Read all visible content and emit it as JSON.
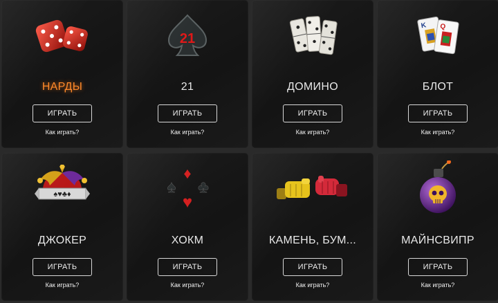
{
  "cards": [
    {
      "title": "НАРДЫ",
      "button": "ИГРАТЬ",
      "howto": "Как играть?",
      "icon": "dice-icon",
      "active": true
    },
    {
      "title": "21",
      "button": "ИГРАТЬ",
      "howto": "Как играть?",
      "icon": "blackjack-spade-icon"
    },
    {
      "title": "ДОМИНО",
      "button": "ИГРАТЬ",
      "howto": "Как играть?",
      "icon": "domino-icon"
    },
    {
      "title": "БЛОТ",
      "button": "ИГРАТЬ",
      "howto": "Как играть?",
      "icon": "playing-cards-icon"
    },
    {
      "title": "ДЖОКЕР",
      "button": "ИГРАТЬ",
      "howto": "Как играть?",
      "icon": "jester-hat-icon"
    },
    {
      "title": "ХОКМ",
      "button": "ИГРАТЬ",
      "howto": "Как играть?",
      "icon": "card-suits-icon"
    },
    {
      "title": "КАМЕНЬ, БУМ...",
      "button": "ИГРАТЬ",
      "howto": "Как играть?",
      "icon": "rock-paper-gloves-icon"
    },
    {
      "title": "МАЙНСВИПР",
      "button": "ИГРАТЬ",
      "howto": "Как играть?",
      "icon": "skull-bomb-icon"
    }
  ],
  "colors": {
    "page_background": "#2a2a2a",
    "card_background": "#161616",
    "active_title": "#ff8a2a",
    "text": "#e8e8e8"
  }
}
